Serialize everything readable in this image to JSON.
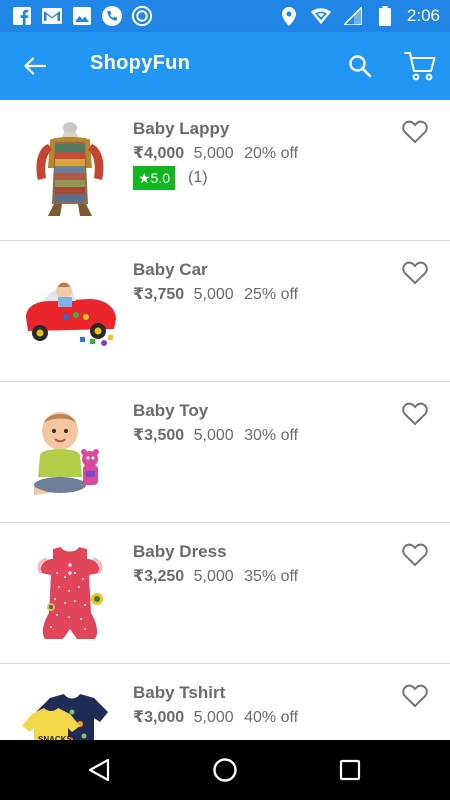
{
  "status_bar": {
    "time": "2:06",
    "left_icons": [
      "facebook-icon",
      "gmail-icon",
      "gallery-icon",
      "phone-icon",
      "app-icon"
    ],
    "right_icons": [
      "location-icon",
      "wifi-icon",
      "signal-icon",
      "battery-icon"
    ]
  },
  "app_bar": {
    "title": "ShopyFun",
    "back_icon": "arrow-back-icon",
    "search_icon": "search-icon",
    "cart_icon": "cart-icon",
    "color": "#2196f3"
  },
  "products": [
    {
      "name": "Baby Lappy",
      "price": "₹4,000",
      "mrp": "5,000",
      "discount": "20% off",
      "rating": "★5.0",
      "rating_count": "(1)",
      "image_icon": "baby-carrier-image"
    },
    {
      "name": "Baby Car",
      "price": "₹3,750",
      "mrp": "5,000",
      "discount": "25% off",
      "image_icon": "toy-car-image"
    },
    {
      "name": "Baby Toy",
      "price": "₹3,500",
      "mrp": "5,000",
      "discount": "30% off",
      "image_icon": "baby-with-toy-image"
    },
    {
      "name": "Baby Dress",
      "price": "₹3,250",
      "mrp": "5,000",
      "discount": "35% off",
      "image_icon": "baby-dress-image"
    },
    {
      "name": "Baby Tshirt",
      "price": "₹3,000",
      "mrp": "5,000",
      "discount": "40% off",
      "image_icon": "baby-tshirt-image"
    }
  ],
  "colors": {
    "status_bar": "#1f86e6",
    "rating_badge": "#12b61e",
    "text": "#6b6b6b"
  },
  "nav_bar": {
    "back_icon": "nav-back-icon",
    "home_icon": "nav-home-icon",
    "recents_icon": "nav-recents-icon"
  }
}
